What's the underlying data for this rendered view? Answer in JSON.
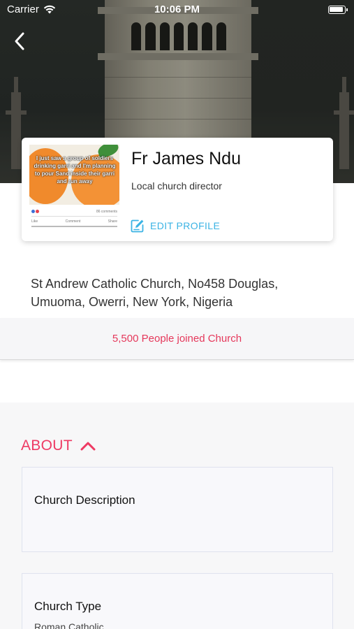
{
  "status_bar": {
    "carrier": "Carrier",
    "time": "10:06 PM"
  },
  "header": {
    "back_icon": "chevron-left-icon"
  },
  "profile": {
    "name": "Fr James Ndu",
    "role": "Local church director",
    "edit_label": "EDIT PROFILE",
    "edit_icon": "edit-icon",
    "thumbnail_text": "I just saw a group of soldiers drinking garri and I'm planning to pour Sand inside their garri and run away",
    "thumbnail_comments": "86 comments",
    "thumbnail_actions": [
      "Like",
      "Comment",
      "Share"
    ]
  },
  "church": {
    "address": "St Andrew Catholic Church, No458 Douglas, Umuoma, Owerri, New York, Nigeria",
    "joined_text": "5,500 People joined Church"
  },
  "about": {
    "title": "ABOUT",
    "toggle_icon": "chevron-up-icon",
    "description_label": "Church Description",
    "description_value": "",
    "type_label": "Church Type",
    "type_value": "Roman Catholic"
  },
  "colors": {
    "accent_pink": "#ee3a63",
    "accent_blue": "#3bb3e4"
  }
}
